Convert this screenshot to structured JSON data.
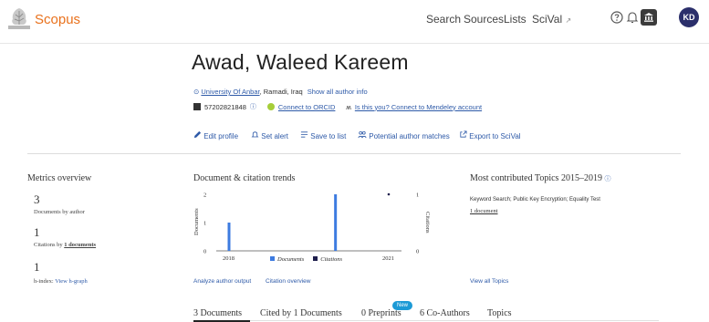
{
  "header": {
    "brand": "Scopus",
    "nav": [
      "Search",
      "Sources",
      "Lists",
      "SciVal"
    ],
    "scival_suffix": "↗",
    "avatar_initials": "KD"
  },
  "author": {
    "name": "Awad, Waleed Kareem",
    "affiliation": "University Of Anbar",
    "location": ", Ramadi, Iraq",
    "show_all_info": "Show all author info",
    "author_id": "57202821848",
    "orcid_link": "Connect to ORCID",
    "mendeley_prefix": "ʍ",
    "mendeley_link": "Is this you? Connect to Mendeley account"
  },
  "actions": [
    {
      "icon": "pencil-icon",
      "label": "Edit profile"
    },
    {
      "icon": "bell-icon",
      "label": "Set alert"
    },
    {
      "icon": "list-icon",
      "label": "Save to list"
    },
    {
      "icon": "people-icon",
      "label": "Potential author matches"
    },
    {
      "icon": "export-icon",
      "label": "Export to SciVal"
    }
  ],
  "metrics": {
    "title": "Metrics overview",
    "documents_value": "3",
    "documents_label": "Documents by author",
    "citations_value": "1",
    "citations_label": "Citations by",
    "citations_docs_link": "1 documents",
    "hindex_value": "1",
    "hindex_label": "h-index:",
    "hgraph_link": "View h-graph"
  },
  "trends": {
    "title": "Document & citation trends",
    "analyze_link": "Analyze author output",
    "citation_overview_link": "Citation overview"
  },
  "chart_data": {
    "type": "bar",
    "title": "",
    "xlabel": "",
    "ylabel": "Documents",
    "y2label": "Citations",
    "x_tick_labels": [
      "2018",
      "2021"
    ],
    "x_range": [
      2018,
      2021
    ],
    "ylim": [
      0,
      2
    ],
    "y_ticks": [
      "0",
      "1",
      "2"
    ],
    "y2lim": [
      0,
      1
    ],
    "y2_ticks": [
      "0",
      "1"
    ],
    "series": [
      {
        "name": "Documents",
        "color": "#3d7be0",
        "type": "bar",
        "x": [
          2018,
          2020
        ],
        "values": [
          1,
          2
        ]
      },
      {
        "name": "Citations",
        "color": "#1f1f4d",
        "type": "point",
        "x": [
          2021
        ],
        "values": [
          1
        ]
      }
    ],
    "legend": "bottom-center",
    "grid": false
  },
  "topics": {
    "title": "Most contributed Topics 2015–2019",
    "info_icon": "info-icon",
    "topic_text": "Keyword Search; Public Key Encryption; Equality Test",
    "topic_docs_link": "1 document",
    "view_all_link": "View all Topics"
  },
  "tabs": [
    {
      "label": "3 Documents"
    },
    {
      "label": "Cited by 1 Documents"
    },
    {
      "label": "0 Preprints"
    },
    {
      "label": "6 Co-Authors"
    },
    {
      "label": "Topics"
    }
  ],
  "new_badge": "New",
  "colors": {
    "brand": "#e9711c",
    "link": "#2e5aa8",
    "bar": "#3d7be0",
    "orcid": "#a6ce39",
    "avatar": "#2b2f6b",
    "badge": "#1c9ad6"
  }
}
